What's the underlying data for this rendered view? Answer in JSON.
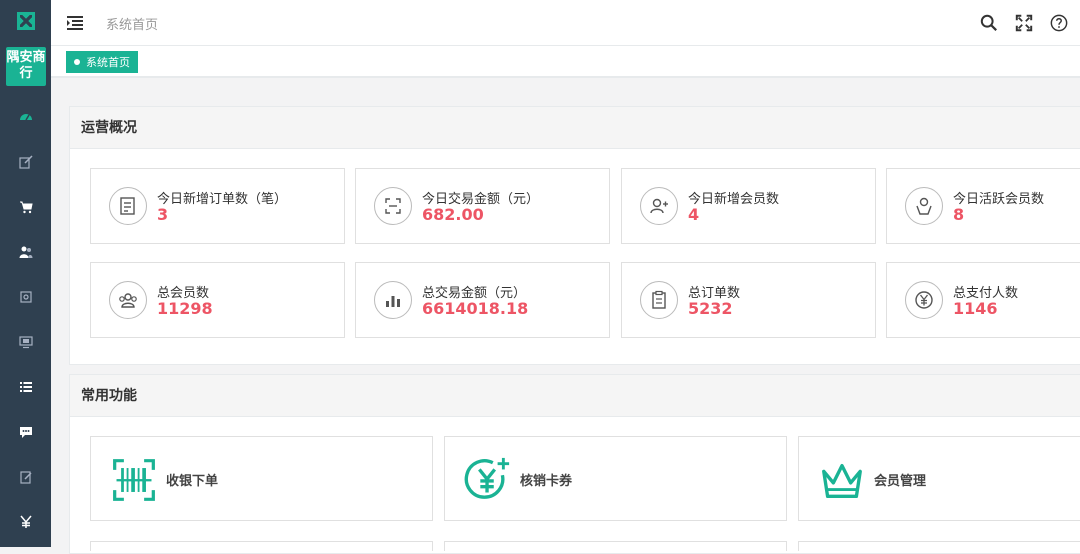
{
  "sidebar": {
    "shop_name": "隅安商行",
    "icons": [
      "dashboard-icon",
      "edit-icon",
      "cart-icon",
      "members-icon",
      "camera-icon",
      "monitor-icon",
      "list-icon",
      "chat-icon",
      "note-icon",
      "yen-icon"
    ]
  },
  "topbar": {
    "title": "系统首页",
    "tools": [
      "search-icon",
      "fullscreen-icon",
      "help-icon"
    ]
  },
  "tabs": [
    {
      "label": "系统首页",
      "active": true
    }
  ],
  "overview": {
    "title": "运营概况",
    "stats": [
      {
        "label": "今日新增订单数（笔）",
        "value": "3",
        "icon": "order-icon"
      },
      {
        "label": "今日交易金额（元）",
        "value": "682.00",
        "icon": "scan-icon"
      },
      {
        "label": "今日新增会员数",
        "value": "4",
        "icon": "add-member-icon"
      },
      {
        "label": "今日活跃会员数",
        "value": "8",
        "icon": "active-member-icon"
      },
      {
        "label": "总会员数",
        "value": "11298",
        "icon": "group-icon"
      },
      {
        "label": "总交易金额（元）",
        "value": "6614018.18",
        "icon": "bar-chart-icon"
      },
      {
        "label": "总订单数",
        "value": "5232",
        "icon": "clipboard-icon"
      },
      {
        "label": "总支付人数",
        "value": "1146",
        "icon": "yen-circle-icon"
      }
    ]
  },
  "functions": {
    "title": "常用功能",
    "items": [
      {
        "label": "收银下单",
        "icon": "barcode-scan-icon"
      },
      {
        "label": "核销卡券",
        "icon": "yen-plus-icon"
      },
      {
        "label": "会员管理",
        "icon": "crown-icon"
      }
    ]
  },
  "colors": {
    "accent": "#1ab394",
    "sidebar": "#2f4050",
    "value": "#ed5565"
  }
}
